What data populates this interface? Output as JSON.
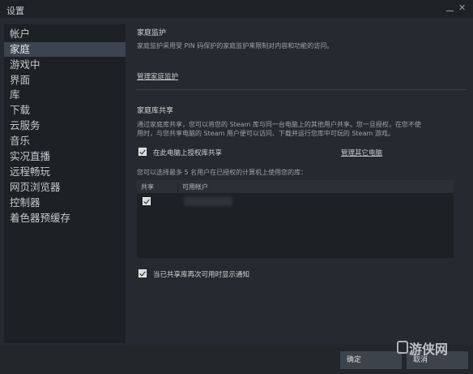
{
  "window": {
    "title": "设置"
  },
  "sidebar": {
    "items": [
      {
        "label": "帐户"
      },
      {
        "label": "家庭"
      },
      {
        "label": "游戏中"
      },
      {
        "label": "界面"
      },
      {
        "label": "库"
      },
      {
        "label": "下载"
      },
      {
        "label": "云服务"
      },
      {
        "label": "音乐"
      },
      {
        "label": "实况直播"
      },
      {
        "label": "远程畅玩"
      },
      {
        "label": "网页浏览器"
      },
      {
        "label": "控制器"
      },
      {
        "label": "着色器预缓存"
      }
    ],
    "active_index": 1
  },
  "family_view": {
    "title": "家庭监护",
    "description": "家庭监护采用受 PIN 码保护的家庭监护来限制对内容和功能的访问。",
    "manage_link": "管理家庭监护"
  },
  "library_sharing": {
    "title": "家庭库共享",
    "description_line1": "通过家庭库共享，您可以将您的 Steam 库与同一台电脑上的其他用户共享。您一旦授权，在您不使",
    "description_line2": "用时，与您共享电脑的 Steam 用户便可以访问、下载并运行您库中可玩的 Steam 游戏。",
    "authorize_label": "在此电脑上授权库共享",
    "authorize_checked": true,
    "manage_devices_link": "管理其它电脑",
    "select_users_text": "您可以选择最多 5 名用户在已授权的计算机上使用您的库：",
    "table": {
      "columns": [
        "共享",
        "可用帐户"
      ],
      "rows": [
        {
          "shared": true,
          "account": ""
        }
      ]
    },
    "notify_label": "当已共享库再次可用时显示通知",
    "notify_checked": true
  },
  "footer": {
    "ok_label": "确定",
    "cancel_label": "取消"
  },
  "watermark": {
    "text": "游侠网"
  },
  "colors": {
    "background": "#262a30",
    "sidebar": "#1d2024",
    "active_item": "#3c4450",
    "button": "#3d434b"
  }
}
